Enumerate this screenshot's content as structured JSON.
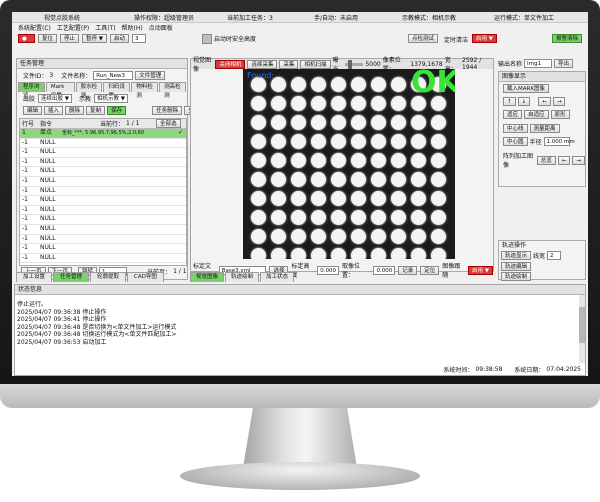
{
  "app": {
    "title": "视觉点胶系统",
    "permission": "操作权限：超级管理员",
    "current_task": "当前加工任务：3",
    "mode": "手/自动：未启用",
    "demo_mode": "示教模式：相机示教",
    "run_mode": "运行模式：单文件加工"
  },
  "menu": [
    "系统配置(C)",
    "工艺配置(P)",
    "工具(T)",
    "帮助(H)",
    "点动面板"
  ],
  "toolbar": {
    "reset": "复位",
    "stop": "停止",
    "pause": "暂停",
    "start": "启动",
    "start_value": "3",
    "safety_label": "启动时安全高度",
    "check_test": "点检测试",
    "scheduled_clean": "定时清洁",
    "scheduled_value": "启用",
    "alarm_clear": "报警清除"
  },
  "task": {
    "header": "任务管理",
    "file_id_label": "文件ID：",
    "file_id": "3",
    "file_name_label": "文件名称：",
    "file_name": "Run_New3",
    "file_manage": "文件管理",
    "tabs": [
      "程序浏览",
      "Mark设置",
      "胶水检测",
      "扫码设置",
      "物料检测",
      "测高检测"
    ],
    "out_label": "出胶",
    "out_value": "连续出胶",
    "demo_label": "示教",
    "demo_value": "相机示教",
    "edit_buttons": [
      "编辑",
      "插入",
      "删除",
      "复制",
      "保存"
    ],
    "delete_current": "任务删除",
    "delete_all": "全部删除",
    "col_row": "行号",
    "col_cmd": "指令",
    "current_row_label": "当前行：",
    "current_row": "1 / 1",
    "select_all": "全部选",
    "rows": [
      {
        "n": "1",
        "cmd": "单点",
        "detail": "坐标_***, 5.96,95.7,96,5%,2.0,60",
        "check": "✓"
      },
      {
        "n": "-1",
        "cmd": "NULL"
      },
      {
        "n": "-1",
        "cmd": "NULL"
      },
      {
        "n": "-1",
        "cmd": "NULL"
      },
      {
        "n": "-1",
        "cmd": "NULL"
      },
      {
        "n": "-1",
        "cmd": "NULL"
      },
      {
        "n": "-1",
        "cmd": "NULL"
      },
      {
        "n": "-1",
        "cmd": "NULL"
      },
      {
        "n": "-1",
        "cmd": "NULL"
      },
      {
        "n": "-1",
        "cmd": "NULL"
      },
      {
        "n": "-1",
        "cmd": "NULL"
      },
      {
        "n": "-1",
        "cmd": "NULL"
      },
      {
        "n": "-1",
        "cmd": "NULL"
      },
      {
        "n": "-1",
        "cmd": "NULL"
      }
    ],
    "prev_page": "上一页",
    "next_page": "下一页",
    "jump": "跳转",
    "jump_value": "1",
    "current_page_label": "当前页：",
    "current_page": "1 / 1"
  },
  "bottom_tabs": [
    "加工设置",
    "任务管理",
    "轮廓提取",
    "CAD导图"
  ],
  "vision": {
    "title": "视觉图像",
    "btn_cam": "关闭相机",
    "btn_cont": "连续采集",
    "btn_acq": "采集",
    "btn_scan": "相机扫描",
    "exposure_label": "曝光",
    "exposure": "5000",
    "pixel_pos_label": "像素位置：",
    "pixel_pos": "1379,1678",
    "width_label": "宽高：",
    "width": "2592 / 1944",
    "found": "Found:",
    "ok": "OK",
    "template_label": "标定文件",
    "template": "Base3.xml",
    "select": "选择",
    "cal_height_label": "标定高度",
    "cal_height": "0.000",
    "take_pos_label": "取像位置：",
    "take_pos": "0.000",
    "record": "记录",
    "locate": "定位",
    "follow_label": "图像跟随",
    "follow_value": "启用",
    "tabs": [
      "视觉图像",
      "轨迹绘制",
      "加工状态"
    ]
  },
  "right": {
    "out_name_label": "输出名称",
    "out_name": "Img1",
    "export": "导出",
    "image_display": "图像显示",
    "load_mark": "载入MARK图像",
    "arrows": [
      "↑",
      "↓",
      "←",
      "→"
    ],
    "fit": "适应",
    "auto_fit": "自适应",
    "native": "原形",
    "center_line": "中心线",
    "measure": "测量距离",
    "center_circle": "中心圆",
    "radius_label": "半径",
    "radius": "1.000",
    "radius_unit": "mm",
    "array_label": "阵列加工图像",
    "array_btn": "总览",
    "track_ops": "轨迹操作",
    "track_show": "轨迹显示",
    "line_width_label": "线宽",
    "line_width": "2",
    "track_edit": "轨迹编辑",
    "track_draw": "轨迹绘制"
  },
  "status": {
    "header": "状态信息",
    "lines": [
      "停止运行。",
      "2025/04/07 09:36:38    停止操作",
      "2025/04/07 09:36:41    停止操作",
      "2025/04/07 09:36:48    是否切换为<单文件加工>运行模式",
      "2025/04/07 09:36:48    切换运行模式为<单文件匹配加工>",
      "2025/04/07 09:36:53    启动加工"
    ],
    "sys_time_label": "系统时间：",
    "sys_time": "09:38:58",
    "sys_date_label": "系统日期：",
    "sys_date": "07:04:2025"
  },
  "colors": {
    "accent_green": "#7ad06a",
    "accent_red": "#d83b3b",
    "ok_green": "#39e33a"
  }
}
